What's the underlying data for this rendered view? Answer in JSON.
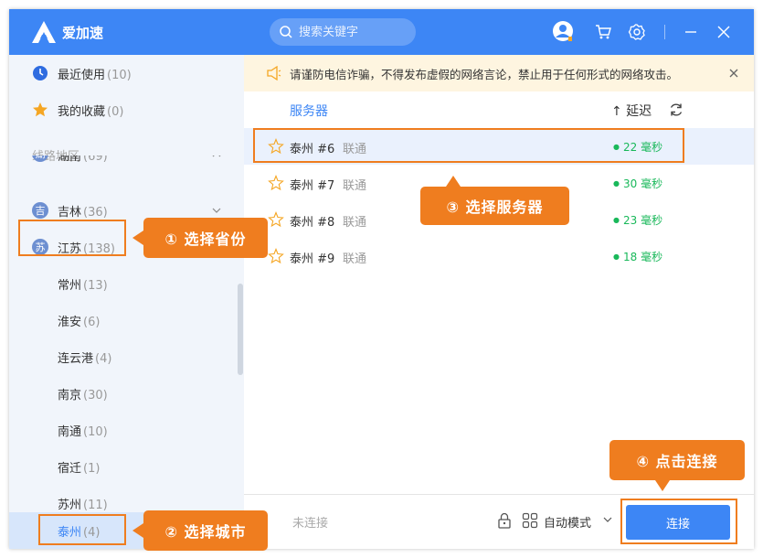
{
  "app": {
    "name": "爱加速"
  },
  "search": {
    "placeholder": "搜索关键字"
  },
  "colors": {
    "accent": "#3d86f5",
    "annotation": "#ef7d1f",
    "latency": "#19b85a",
    "notice_bg": "#fef5e0"
  },
  "sidebar": {
    "recent": {
      "label": "最近使用",
      "count": "(10)"
    },
    "favorites": {
      "label": "我的收藏",
      "count": "(0)"
    },
    "section_label": "线路地区",
    "provinces": [
      {
        "badge": "湖",
        "label": "湖南",
        "count": "(69)"
      },
      {
        "badge": "吉",
        "label": "吉林",
        "count": "(36)"
      },
      {
        "badge": "苏",
        "label": "江苏",
        "count": "(138)"
      }
    ],
    "cities": [
      {
        "label": "常州",
        "count": "(13)"
      },
      {
        "label": "淮安",
        "count": "(6)"
      },
      {
        "label": "连云港",
        "count": "(4)"
      },
      {
        "label": "南京",
        "count": "(30)"
      },
      {
        "label": "南通",
        "count": "(10)"
      },
      {
        "label": "宿迁",
        "count": "(1)"
      },
      {
        "label": "苏州",
        "count": "(11)"
      },
      {
        "label": "泰州",
        "count": "(4)"
      }
    ]
  },
  "notice": {
    "text": "请谨防电信诈骗，不得发布虚假的网络言论，禁止用于任何形式的网络攻击。"
  },
  "list": {
    "header_server": "服务器",
    "header_latency": "↑ 延迟",
    "servers": [
      {
        "name": "泰州 #6",
        "isp": "联通",
        "latency": "22 毫秒"
      },
      {
        "name": "泰州 #7",
        "isp": "联通",
        "latency": "30 毫秒"
      },
      {
        "name": "泰州 #8",
        "isp": "联通",
        "latency": "23 毫秒"
      },
      {
        "name": "泰州 #9",
        "isp": "联通",
        "latency": "18 毫秒"
      }
    ]
  },
  "footer": {
    "status": "未连接",
    "mode": "自动模式",
    "connect": "连接"
  },
  "callouts": {
    "step1": "① 选择省份",
    "step2": "② 选择城市",
    "step3": "③ 选择服务器",
    "step4": "④ 点击连接"
  }
}
